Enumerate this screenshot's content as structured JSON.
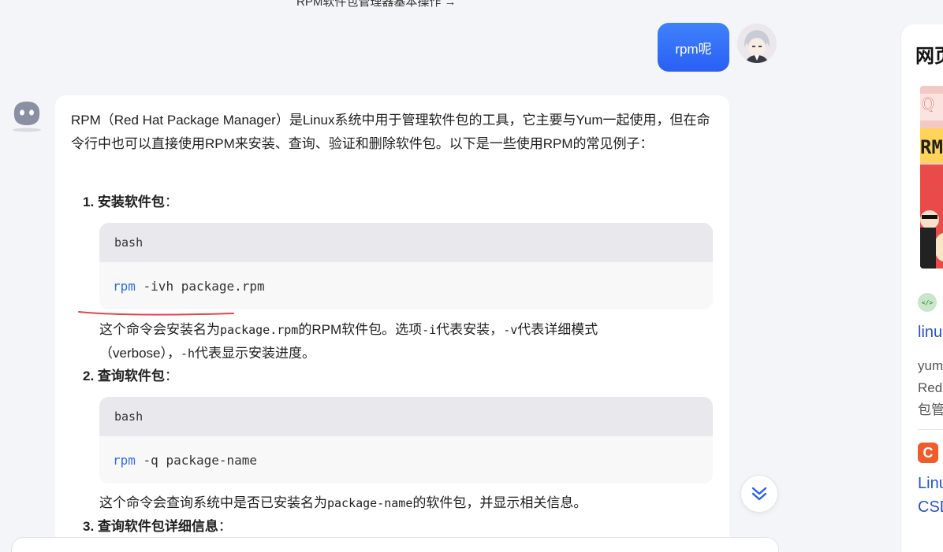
{
  "header": {
    "breadcrumb": "RPM软件包管理器基本操作 →"
  },
  "user_message": {
    "text": "rpm呢"
  },
  "answer": {
    "intro": "RPM（Red Hat Package Manager）是Linux系统中用于管理软件包的工具，它主要与Yum一起使用，但在命令行中也可以直接使用RPM来安装、查询、验证和删除软件包。以下是一些使用RPM的常见例子：",
    "steps": [
      {
        "number": "1.",
        "title": "安装软件包",
        "suffix": "：",
        "code_lang": "bash",
        "code_cmd": "rpm",
        "code_args": " -ivh package.rpm",
        "desc_parts": [
          "这个命令会安装名为",
          "package.rpm",
          "的RPM软件包。选项",
          "-i",
          "代表安装，",
          "-v",
          "代表详细模式（verbose），",
          "-h",
          "代表显示安装进度。"
        ]
      },
      {
        "number": "2.",
        "title": "查询软件包",
        "suffix": "：",
        "code_lang": "bash",
        "code_cmd": "rpm",
        "code_args": " -q package-name",
        "desc_parts": [
          "这个命令会查询系统中是否已安装名为",
          "package-name",
          "的软件包，并显示相关信息。"
        ]
      },
      {
        "number": "3.",
        "title": "查询软件包详细信息",
        "suffix": "："
      }
    ]
  },
  "right_panel": {
    "title": "网页",
    "result1": {
      "icon": "code-icon",
      "link": "linu",
      "snippet": [
        "yum",
        "Red",
        "包管"
      ]
    },
    "result2": {
      "icon": "csdn-icon",
      "icon_letter": "C",
      "link": [
        "Linu",
        "CSD"
      ]
    }
  },
  "colors": {
    "accent": "#2a5ff5",
    "code_keyword": "#2f6fe0",
    "link": "#2654c6",
    "annotation_red": "#e0474c"
  }
}
